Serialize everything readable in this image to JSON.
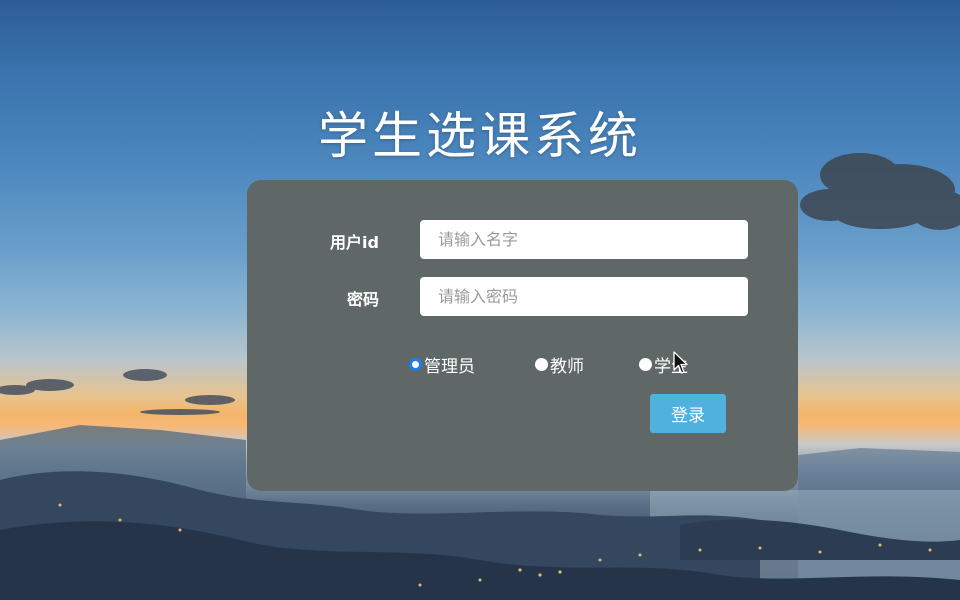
{
  "app": {
    "title": "学生选课系统"
  },
  "login_form": {
    "user_id_label": "用户id",
    "user_id_value": "",
    "user_id_placeholder": "请输入名字",
    "password_label": "密码",
    "password_value": "",
    "password_placeholder": "请输入密码",
    "roles": [
      {
        "label": "管理员",
        "selected": true
      },
      {
        "label": "教师",
        "selected": false
      },
      {
        "label": "学生",
        "selected": false
      }
    ],
    "submit_label": "登录"
  },
  "colors": {
    "panel_bg": "#5f6867",
    "button_bg": "#4fb2de",
    "radio_checked": "#1f7cf0",
    "text": "#ffffff"
  },
  "icons": {
    "cursor": "mouse-pointer-icon"
  }
}
